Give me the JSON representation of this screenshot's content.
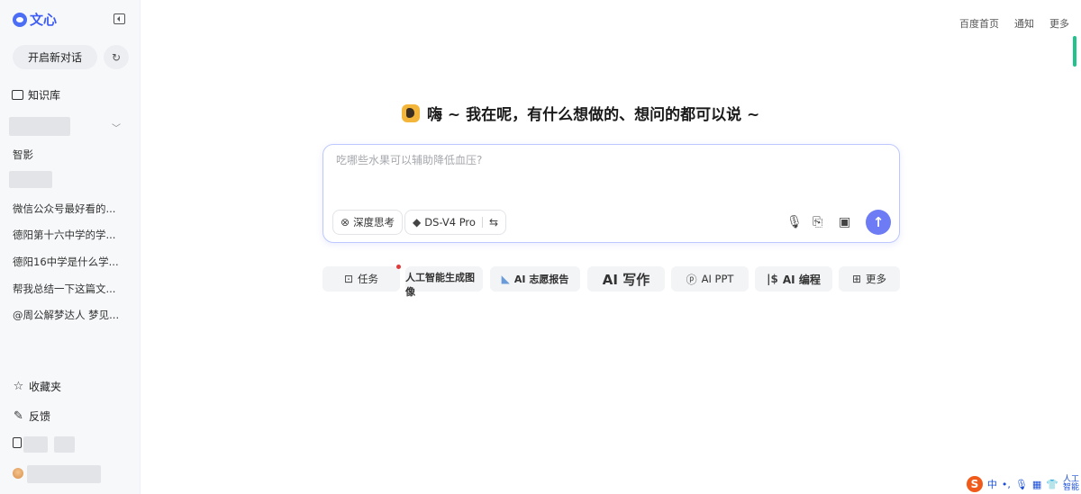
{
  "sidebar": {
    "logo_text": "文心",
    "new_chat_label": "开启新对话",
    "knowledge_label": "知识库",
    "items": [
      {
        "label": "智影"
      },
      {
        "label": "微信公众号最好看的..."
      },
      {
        "label": "德阳第十六中学的学..."
      },
      {
        "label": "德阳16中学是什么学..."
      },
      {
        "label": "帮我总结一下这篇文..."
      },
      {
        "label": "@周公解梦达人 梦见..."
      }
    ],
    "favorites_label": "收藏夹",
    "feedback_label": "反馈"
  },
  "topnav": {
    "home": "百度首页",
    "notify": "通知",
    "more": "更多"
  },
  "main": {
    "greeting": "嗨 ~ 我在呢，有什么想做的、想问的都可以说 ~",
    "input_placeholder": "吃哪些水果可以辅助降低血压?",
    "deep_think_label": "深度思考",
    "model_label": "DS-V4 Pro",
    "quick_actions": [
      {
        "label": "任务"
      },
      {
        "label": "人工智能生成图像"
      },
      {
        "label": "AI 志愿报告"
      },
      {
        "label": "AI 写作"
      },
      {
        "label": "AI PPT"
      },
      {
        "label": "AI 编程"
      },
      {
        "label": "更多"
      }
    ]
  },
  "ime": {
    "mode": "中",
    "punct": "•,",
    "ai_line1": "人工",
    "ai_line2": "智能"
  },
  "colors": {
    "accent": "#4c6ef5",
    "send": "#6d7cf4",
    "scroll": "#20c48a"
  }
}
